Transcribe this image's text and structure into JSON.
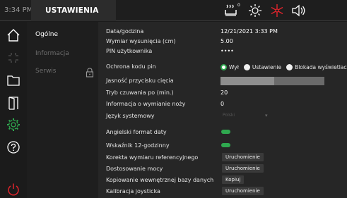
{
  "topbar": {
    "clock": "3:34 PM",
    "title": "USTAWIENIA",
    "icons": [
      "tray-heat-icon",
      "brightness-icon",
      "cooling-icon",
      "volume-icon"
    ],
    "tray_superscript": "0"
  },
  "nav": {
    "icons": [
      "home-icon",
      "crosshair-icon",
      "folder-icon",
      "door-icon",
      "settings-gear-icon",
      "help-icon",
      "power-icon"
    ],
    "active": "settings-gear-icon",
    "accent_color": "#2fa84f",
    "power_color": "#e0242c"
  },
  "menu": {
    "items": [
      {
        "label": "Ogólne",
        "active": true
      },
      {
        "label": "Informacja",
        "active": false
      },
      {
        "label": "Serwis",
        "active": false,
        "locked": true
      }
    ]
  },
  "settings": {
    "date_time": {
      "label": "Data/godzina",
      "value": "12/21/2021 3:33 PM"
    },
    "feed_dimension": {
      "label": "Wymiar wysunięcia (cm)",
      "value": "5.00"
    },
    "pin": {
      "label": "PIN użytkownika",
      "value": "••••"
    },
    "pin_protection": {
      "label": "Ochrona kodu pin",
      "options": [
        "Wył",
        "Ustawienie",
        "Blokada wyświetlacza"
      ],
      "selected": "Wył"
    },
    "cut_button_brightness": {
      "label": "Jasność przycisku cięcia",
      "level_percent": 52
    },
    "standby": {
      "label": "Tryb czuwania po (min.)",
      "value": "20"
    },
    "knife_info": {
      "label": "Informacja o wymianie noży",
      "value": "0"
    },
    "language": {
      "label": "Język systemowy",
      "value": "Polski",
      "chevron": "▾"
    },
    "english_date": {
      "label": "Angielski format daty",
      "enabled": true
    },
    "clock_12h": {
      "label": "Wskaźnik 12-godzinny",
      "enabled": true
    },
    "ref_correction": {
      "label": "Korekta wymiaru referencyjnego",
      "button": "Uruchomienie"
    },
    "power_adjust": {
      "label": "Dostosowanie mocy",
      "button": "Uruchomienie"
    },
    "db_copy": {
      "label": "Kopiowanie wewnętrznej bazy danych",
      "button": "Kopiuj"
    },
    "joystick_calibration": {
      "label": "Kalibracja joysticka",
      "button": "Uruchomienie"
    }
  }
}
